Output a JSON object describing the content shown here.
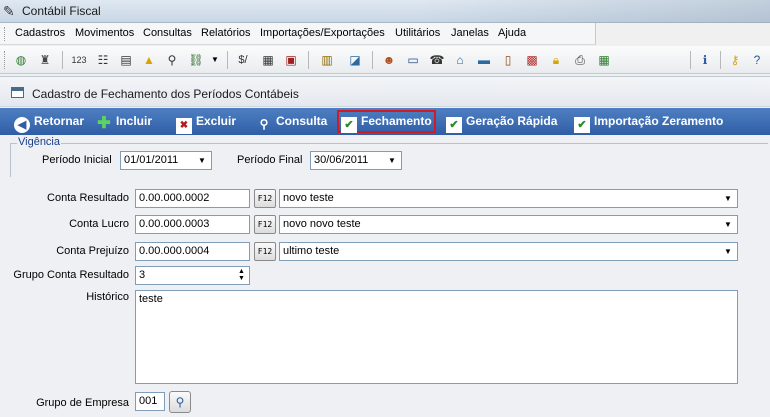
{
  "window": {
    "title": "Contábil Fiscal"
  },
  "menu": [
    "Cadastros",
    "Movimentos",
    "Consultas",
    "Relatórios",
    "Importações/Exportações",
    "Utilitários",
    "Janelas",
    "Ajuda"
  ],
  "form": {
    "title": "Cadastro de Fechamento dos Períodos Contábeis"
  },
  "actions": {
    "retornar": "Retornar",
    "incluir": "Incluir",
    "excluir": "Excluir",
    "consulta": "Consulta",
    "fechamento": "Fechamento",
    "geracao": "Geração Rápida",
    "importacao": "Importação Zeramento"
  },
  "vigencia": {
    "legend": "Vigência",
    "periodo_inicial_label": "Período Inicial",
    "periodo_inicial": "01/01/2011",
    "periodo_final_label": "Período Final",
    "periodo_final": "30/06/2011"
  },
  "fields": {
    "f12_label": "F12",
    "conta_resultado_label": "Conta Resultado",
    "conta_resultado_code": "0.00.000.0002",
    "conta_resultado_desc": "novo teste",
    "conta_lucro_label": "Conta Lucro",
    "conta_lucro_code": "0.00.000.0003",
    "conta_lucro_desc": "novo novo teste",
    "conta_prejuizo_label": "Conta Prejuízo",
    "conta_prejuizo_code": "0.00.000.0004",
    "conta_prejuizo_desc": "ultimo teste",
    "grupo_conta_label": "Grupo Conta Resultado",
    "grupo_conta_value": "3",
    "historico_label": "Histórico",
    "historico_value": "teste",
    "grupo_empresa_label": "Grupo de Empresa",
    "grupo_empresa_value": "001"
  },
  "colors": {
    "action_bar": "#3a68b0",
    "selected_border": "#d11b24",
    "field_border": "#7f9db9"
  }
}
